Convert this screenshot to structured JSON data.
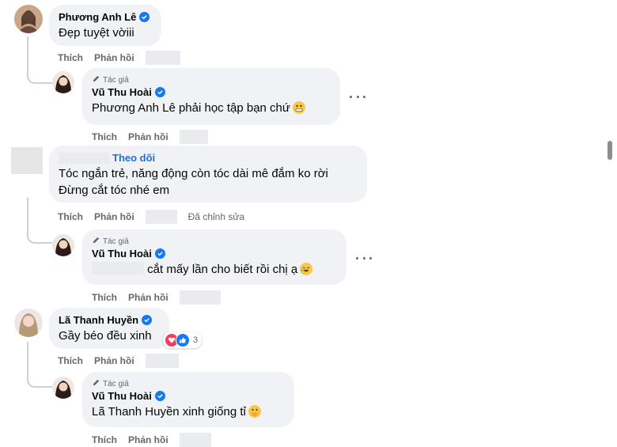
{
  "comments": [
    {
      "author": "Phương Anh Lê",
      "text": "Đẹp tuyệt vờiii",
      "actions": {
        "like": "Thích",
        "reply": "Phản hồi"
      },
      "reply": {
        "badge": "Tác giả",
        "author": "Vũ Thu Hoài",
        "mention": "Phương Anh Lê",
        "text": " phải học tập bạn chứ",
        "actions": {
          "like": "Thích",
          "reply": "Phản hồi"
        }
      }
    },
    {
      "follow_label": "Theo dõi",
      "text_line1": "Tóc ngắn trẻ, năng động còn tóc dài mê đắm ko rời",
      "text_line2": "Đừng cắt tóc nhé em",
      "actions": {
        "like": "Thích",
        "reply": "Phản hồi",
        "edited": "Đã chỉnh sửa"
      },
      "reply": {
        "badge": "Tác giả",
        "author": "Vũ Thu Hoài",
        "text": "cắt mấy lần cho biết rồi chị ạ",
        "actions": {
          "like": "Thích",
          "reply": "Phản hồi"
        }
      }
    },
    {
      "author": "Lã Thanh Huyền",
      "text": "Gầy béo đều xinh",
      "reaction_count": "3",
      "actions": {
        "like": "Thích",
        "reply": "Phản hồi"
      },
      "reply": {
        "badge": "Tác giả",
        "author": "Vũ Thu Hoài",
        "mention": "Lã Thanh Huyền",
        "text": " xinh giống tỉ",
        "actions": {
          "like": "Thích",
          "reply": "Phản hồi"
        }
      }
    }
  ],
  "colors": {
    "bubble": "#f0f2f5",
    "verified": "#1877f2",
    "link": "#216fdb",
    "muted": "#65676b"
  }
}
